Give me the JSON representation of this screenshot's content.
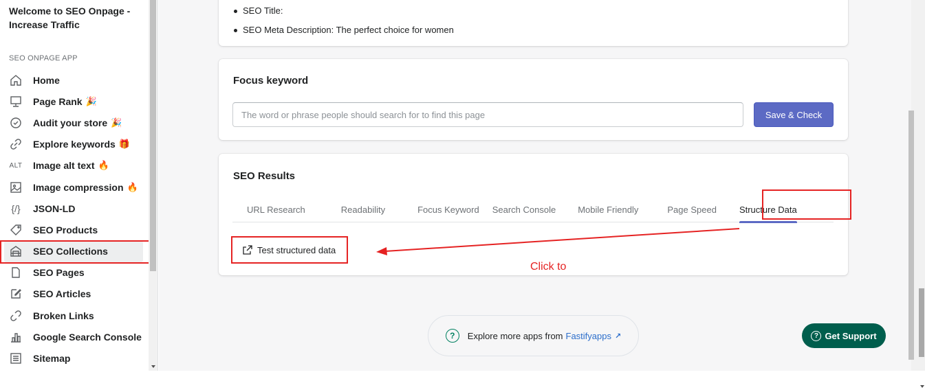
{
  "sidebar": {
    "welcome": "Welcome to SEO Onpage - Increase Traffic",
    "app_label": "SEO ONPAGE APP",
    "items": [
      {
        "label": "Home",
        "icon": "home-icon",
        "badge": ""
      },
      {
        "label": "Page Rank",
        "icon": "monitor-icon",
        "badge": "🎉"
      },
      {
        "label": "Audit your store",
        "icon": "check-circle-icon",
        "badge": "🎉"
      },
      {
        "label": "Explore keywords",
        "icon": "link-icon",
        "badge": "🎁"
      },
      {
        "label": "Image alt text",
        "icon": "alt-icon",
        "badge": "🔥"
      },
      {
        "label": "Image compression",
        "icon": "image-icon",
        "badge": "🔥"
      },
      {
        "label": "JSON-LD",
        "icon": "braces-icon",
        "badge": ""
      },
      {
        "label": "SEO Products",
        "icon": "tag-icon",
        "badge": ""
      },
      {
        "label": "SEO Collections",
        "icon": "collection-icon",
        "badge": ""
      },
      {
        "label": "SEO Pages",
        "icon": "page-icon",
        "badge": ""
      },
      {
        "label": "SEO Articles",
        "icon": "edit-icon",
        "badge": ""
      },
      {
        "label": "Broken Links",
        "icon": "broken-link-icon",
        "badge": ""
      },
      {
        "label": "Google Search Console",
        "icon": "chart-icon",
        "badge": ""
      },
      {
        "label": "Sitemap",
        "icon": "list-icon",
        "badge": ""
      }
    ],
    "alt_icon_text": "ALT",
    "json_icon_text": "{/}"
  },
  "meta_card": {
    "seo_title": "SEO Title:",
    "seo_meta": "SEO Meta Description: The perfect choice for women"
  },
  "focus_card": {
    "title": "Focus keyword",
    "input_placeholder": "The word or phrase people should search for to find this page",
    "input_value": "",
    "save_label": "Save & Check"
  },
  "results_card": {
    "title": "SEO Results",
    "tabs": [
      "URL Research",
      "Readability",
      "Focus Keyword",
      "Search Console",
      "Mobile Friendly",
      "Page Speed",
      "Structure Data"
    ],
    "active_tab": "Structure Data",
    "test_button": "Test structured data"
  },
  "annotation": {
    "text": "Click to",
    "color": "#e52222"
  },
  "footer": {
    "explore_text": "Explore more apps from",
    "explore_link": "Fastifyapps",
    "support_label": "Get Support"
  },
  "colors": {
    "primary": "#5c6ac4",
    "support": "#005e4d",
    "annotation": "#e52222",
    "link": "#2c6ecb"
  }
}
